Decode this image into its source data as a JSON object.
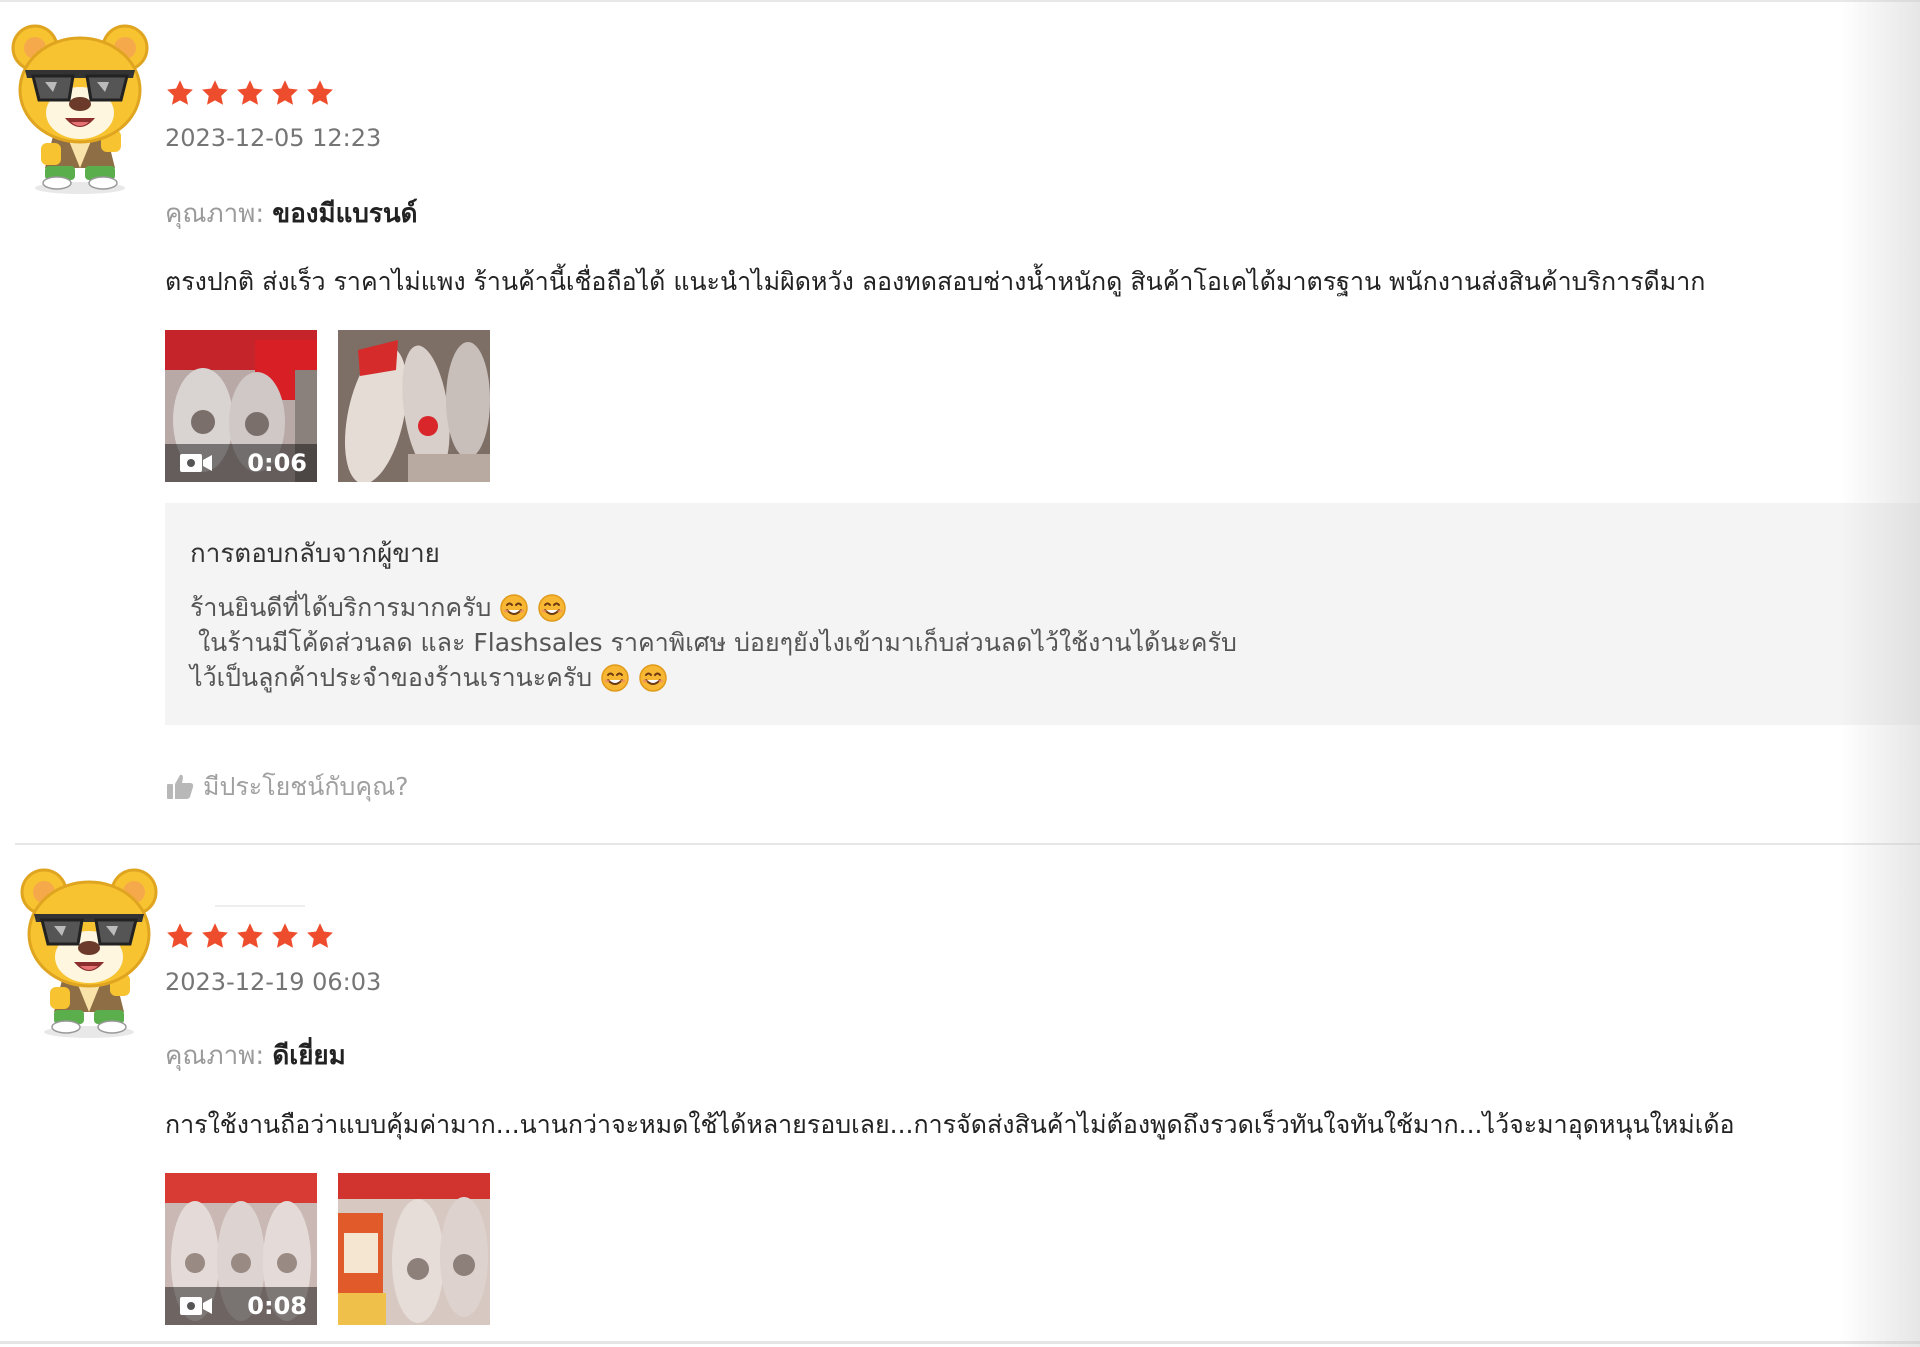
{
  "reviews": [
    {
      "rating": 5,
      "timestamp": "2023-12-05 12:23",
      "quality_label": "คุณภาพ:",
      "quality_value": "ของมีแบรนด์",
      "text": "ตรงปกติ ส่งเร็ว ราคาไม่แพง ร้านค้านี้เชื่อถือได้ แนะนำไม่ผิดหวัง ลองทดสอบช่างน้ำหนักดู สินค้าโอเคได้มาตรฐาน พนักงานส่งสินค้าบริการดีมาก",
      "media": [
        {
          "type": "video",
          "duration": "0:06"
        },
        {
          "type": "image"
        }
      ]
    },
    {
      "rating": 5,
      "timestamp": "2023-12-19 06:03",
      "quality_label": "คุณภาพ:",
      "quality_value": "ดีเยี่ยม",
      "text": "การใช้งานถือว่าแบบคุ้มค่ามาก...นานกว่าจะหมดใช้ได้หลายรอบเลย...การจัดส่งสินค้าไม่ต้องพูดถึงรวดเร็วทันใจทันใช้มาก...ไว้จะมาอุดหนุนใหม่เด้อ",
      "media": [
        {
          "type": "video",
          "duration": "0:08"
        },
        {
          "type": "image"
        }
      ]
    }
  ],
  "seller_reply": {
    "title": "การตอบกลับจากผู้ขาย",
    "lines": [
      "ร้านยินดีที่ได้บริการมากครับ",
      " ในร้านมีโค้ดส่วนลด และ Flashsales ราคาพิเศษ บ่อยๆยังไงเข้ามาเก็บส่วนลดไว้ใช้งานได้นะครับ",
      "ไว้เป็นลูกค้าประจำของร้านเรานะครับ"
    ]
  },
  "helpful_label": "มีประโยชน์กับคุณ?",
  "colors": {
    "star": "#ee4d2d",
    "reply_bg": "#f4f4f4",
    "muted_text": "#757575"
  },
  "icons": {
    "avatar": "bear-mascot-avatar",
    "star": "star-icon",
    "video": "video-camera-icon",
    "emoji": "smiling-face-emoji",
    "helpful": "thumbs-up-icon"
  }
}
